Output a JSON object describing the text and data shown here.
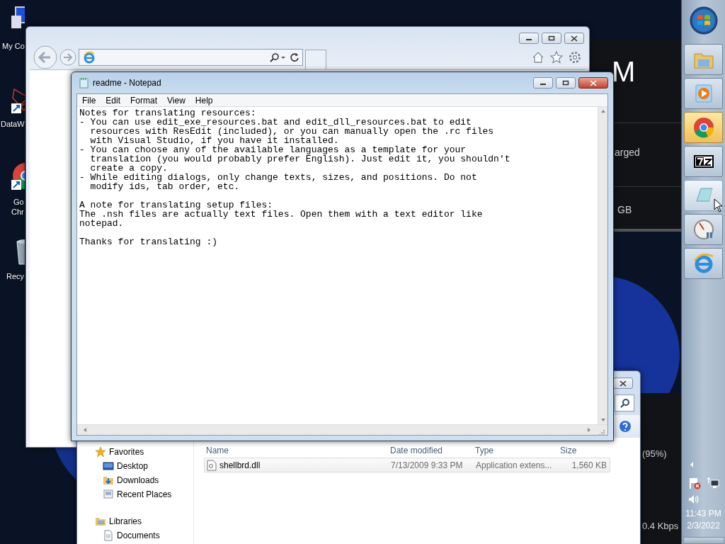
{
  "desktop_icons": [
    {
      "kind": "computer",
      "lines": [
        "My Co"
      ]
    },
    {
      "kind": "molecule",
      "lines": [
        "DataW"
      ]
    },
    {
      "kind": "chrome",
      "lines": [
        "Go",
        "Chr"
      ]
    },
    {
      "kind": "recycle",
      "lines": [
        "Recy"
      ]
    }
  ],
  "gadget": {
    "heading": "M",
    "texts": [
      "arged",
      "GB"
    ],
    "lower_texts": [
      "(95%)",
      "0.4 Kbps"
    ]
  },
  "notepad": {
    "title": "readme - Notepad",
    "menu": [
      "File",
      "Edit",
      "Format",
      "View",
      "Help"
    ],
    "text": "Notes for translating resources:\n- You can use edit_exe_resources.bat and edit_dll_resources.bat to edit\n  resources with ResEdit (included), or you can manually open the .rc files\n  with Visual Studio, if you have it installed.\n- You can choose any of the available languages as a template for your\n  translation (you would probably prefer English). Just edit it, you shouldn't\n  create a copy.\n- While editing dialogs, only change texts, sizes, and positions. Do not\n  modify ids, tab order, etc.\n\nA note for translating setup files:\nThe .nsh files are actually text files. Open them with a text editor like\nnotepad.\n\nThanks for translating :)"
  },
  "explorer": {
    "nav": [
      {
        "kind": "favorites",
        "label": "Favorites",
        "children": [
          {
            "kind": "desktop",
            "label": "Desktop"
          },
          {
            "kind": "downloads",
            "label": "Downloads"
          },
          {
            "kind": "recent",
            "label": "Recent Places"
          }
        ]
      },
      {
        "kind": "libraries",
        "label": "Libraries",
        "children": [
          {
            "kind": "documents",
            "label": "Documents"
          }
        ]
      }
    ],
    "columns": [
      "Name",
      "Date modified",
      "Type",
      "Size"
    ],
    "rows": [
      {
        "cells": [
          "shellbrd.dll",
          "7/13/2009 9:33 PM",
          "Application extens...",
          "1,560 KB"
        ],
        "highlighted": true
      }
    ]
  },
  "taskbar": {
    "buttons": [
      {
        "kind": "explorer",
        "flashing": false,
        "hovered": false
      },
      {
        "kind": "media",
        "flashing": false,
        "hovered": false
      },
      {
        "kind": "chrome",
        "flashing": true,
        "hovered": false
      },
      {
        "kind": "sevenzip",
        "flashing": false,
        "hovered": false
      },
      {
        "kind": "notepad",
        "flashing": false,
        "hovered": true
      },
      {
        "kind": "gauge",
        "flashing": false,
        "hovered": false
      },
      {
        "kind": "ie",
        "flashing": false,
        "hovered": false
      }
    ],
    "clock": {
      "time": "11:43 PM",
      "date": "2/3/2022"
    }
  }
}
